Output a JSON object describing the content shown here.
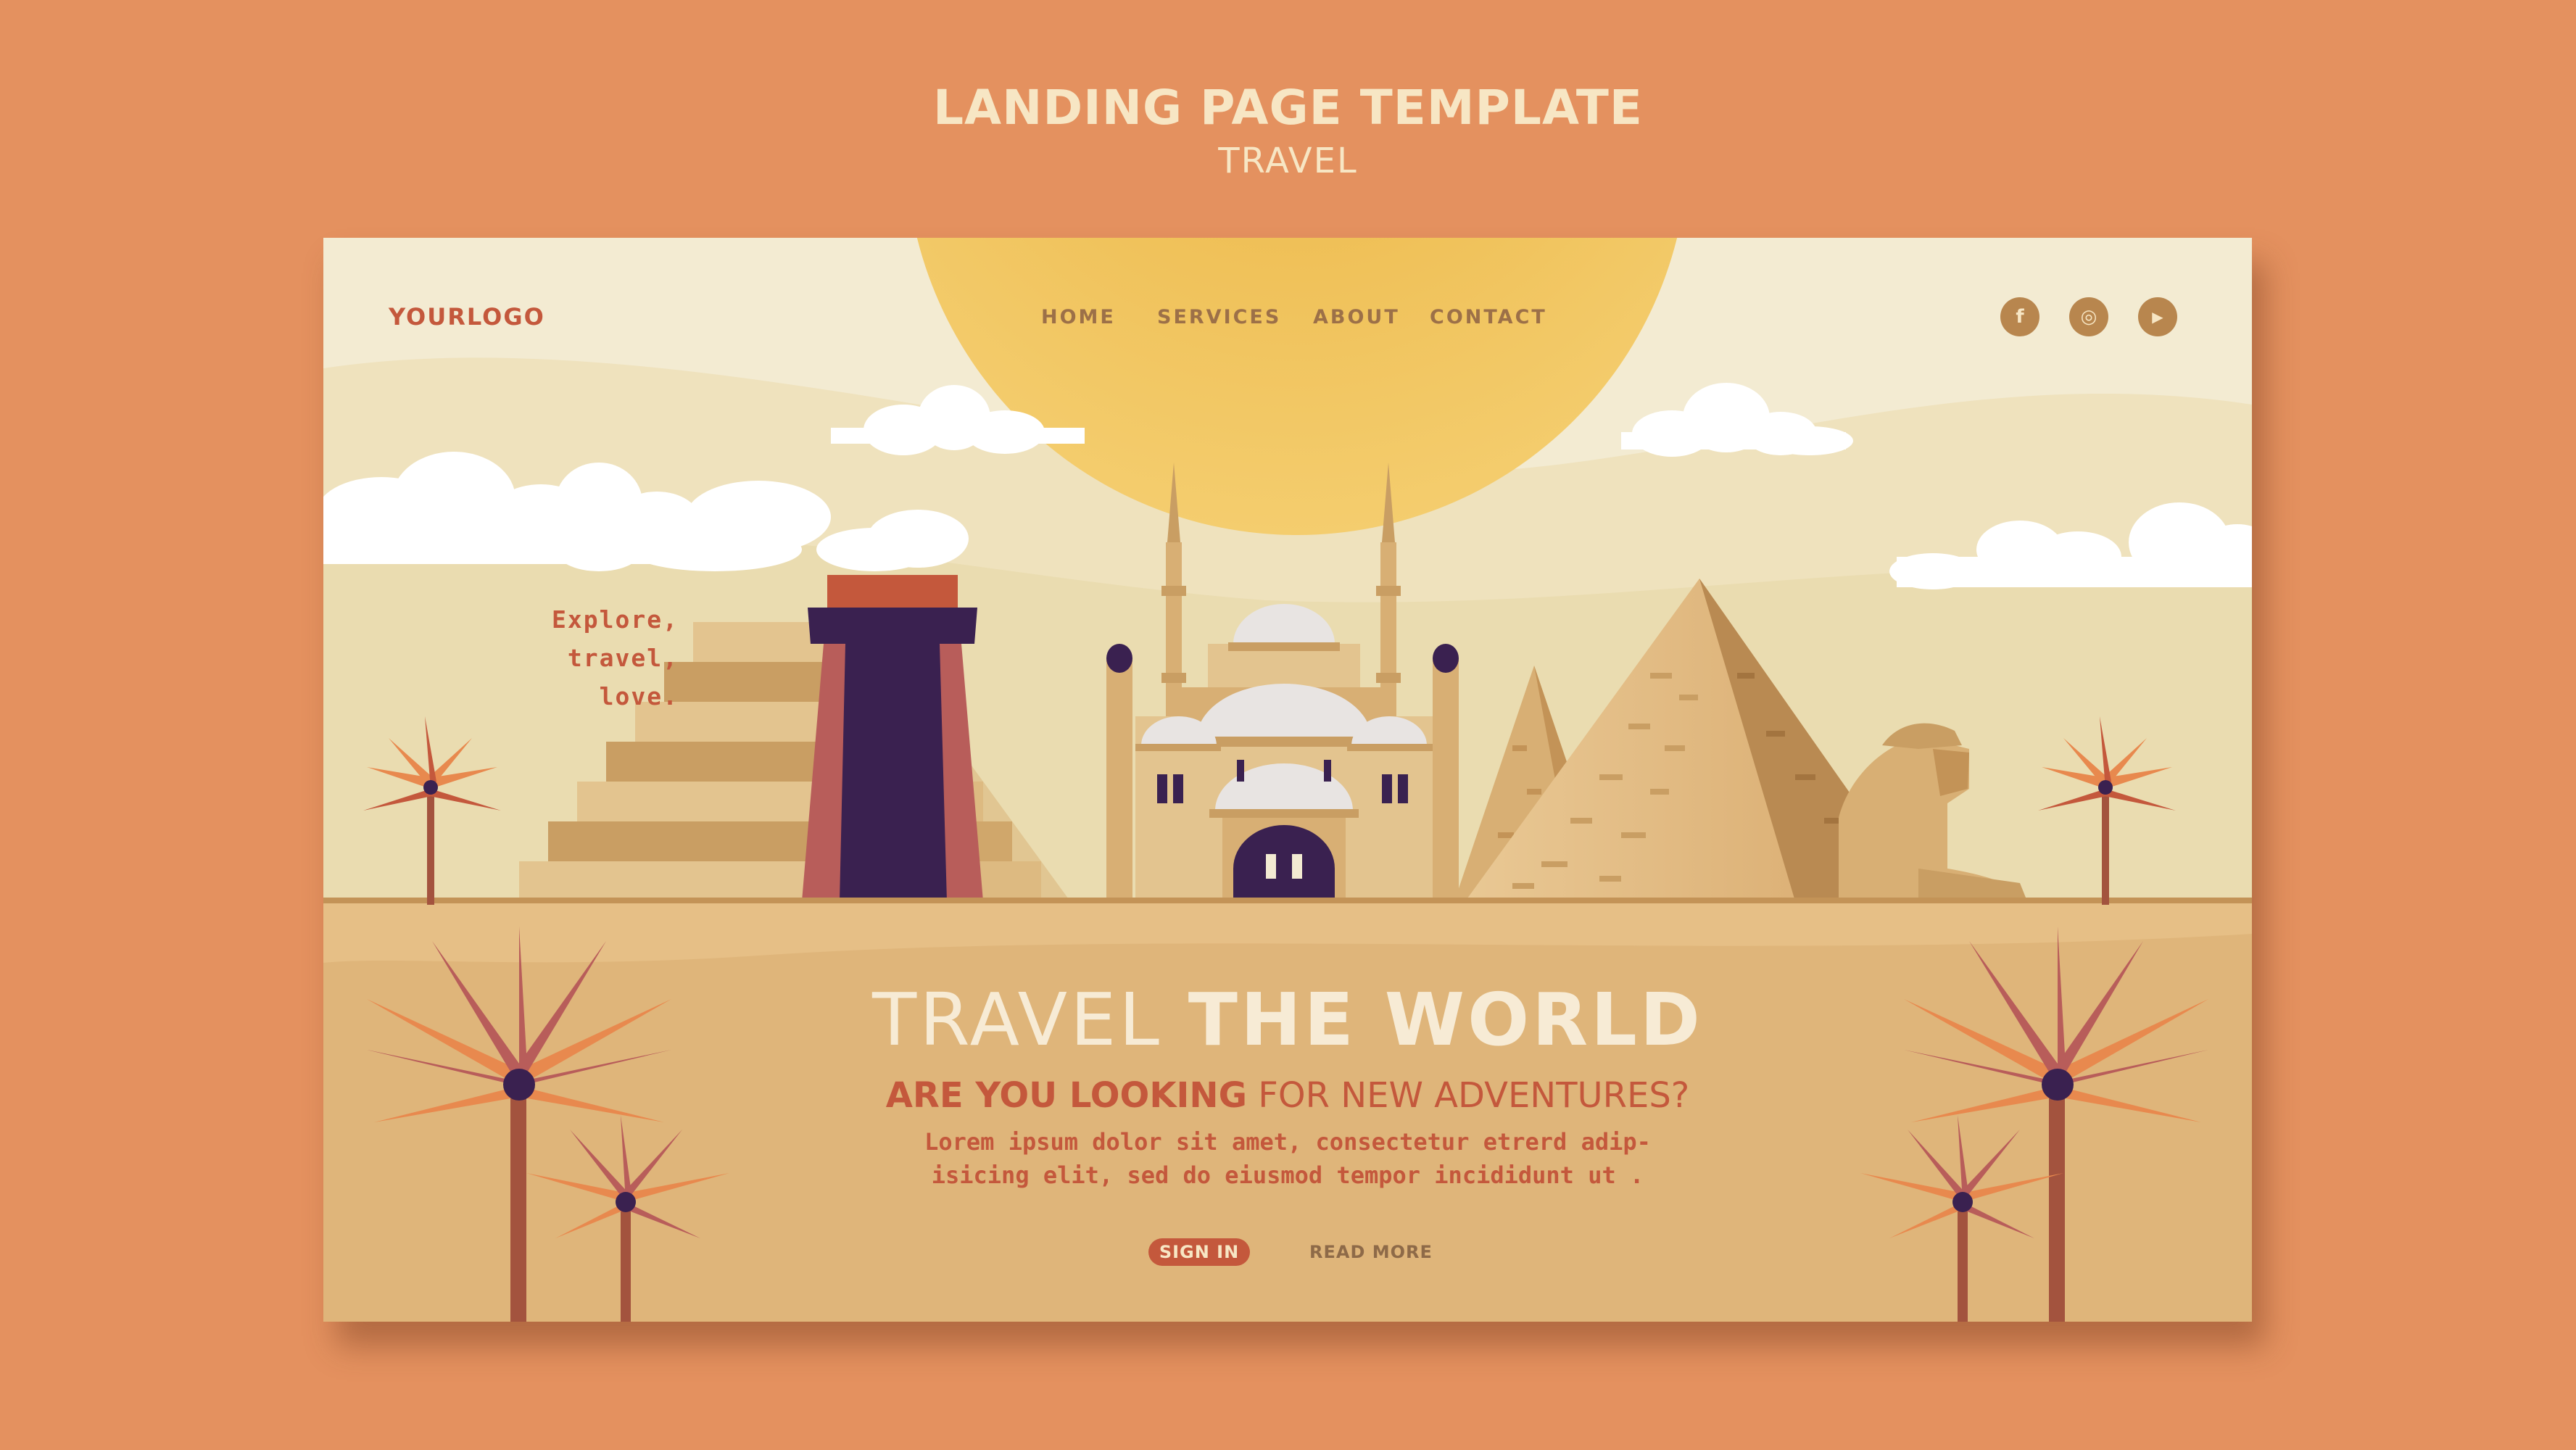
{
  "header": {
    "title": "LANDING PAGE TEMPLATE",
    "subtitle": "TRAVEL"
  },
  "site": {
    "logo": "YOURLOGO",
    "nav": [
      {
        "label": "HOME"
      },
      {
        "label": "SERVICES"
      },
      {
        "label": "ABOUT"
      },
      {
        "label": "CONTACT"
      }
    ],
    "social": [
      {
        "icon": "facebook-icon",
        "glyph": "f"
      },
      {
        "icon": "instagram-icon",
        "glyph": "◎"
      },
      {
        "icon": "youtube-icon",
        "glyph": "▶"
      }
    ],
    "tagline": [
      "Explore,",
      "travel,",
      "love."
    ]
  },
  "hero": {
    "title_light": "TRAVEL ",
    "title_bold": "THE WORLD",
    "subtitle_bold": "ARE YOU LOOKING",
    "subtitle_rest": " FOR NEW ADVENTURES?",
    "body_lines": [
      "Lorem ipsum dolor sit amet, consectetur etrerd adip-",
      "isicing elit, sed do eiusmod tempor incididunt ut ."
    ],
    "sign_in_label": "SIGN IN",
    "read_more_label": "READ MORE"
  },
  "colors": {
    "page_background": "#E4915F",
    "sky": "#F3EBD2",
    "sun": "#F0C35B",
    "sand": "#DFB57A",
    "accent": "#C4583C",
    "dark_purple": "#3A2150",
    "cream_text": "#F7E6C4"
  }
}
